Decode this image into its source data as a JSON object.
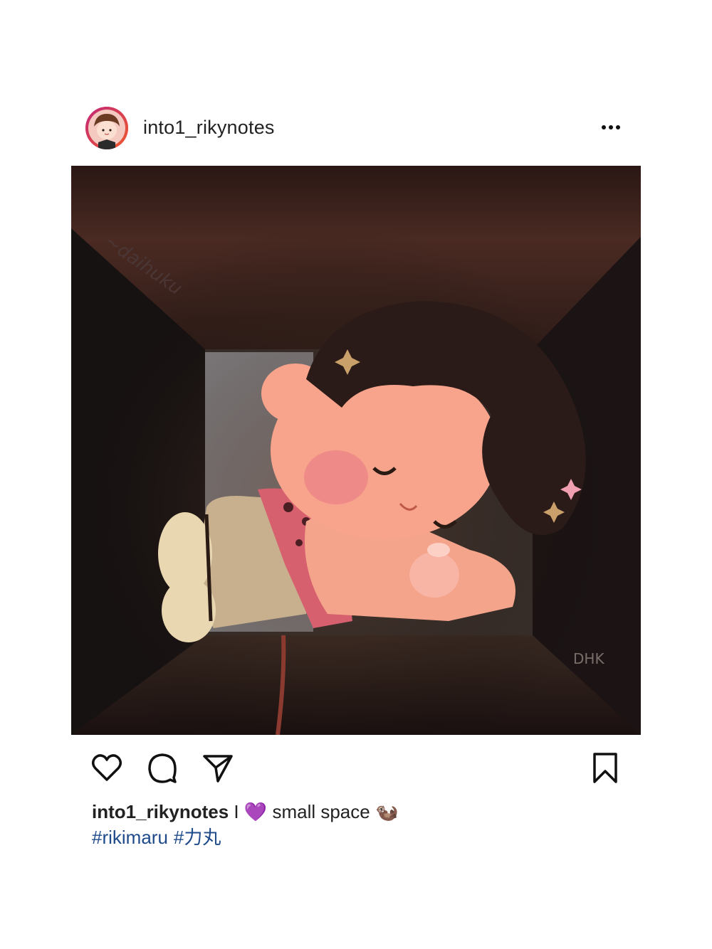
{
  "post": {
    "username": "into1_rikynotes",
    "caption_user": "into1_rikynotes",
    "caption_text": "I 💜 small space 🦦",
    "hashtags": [
      "#rikimaru",
      "#力丸"
    ],
    "image_watermark_top": "~daihuku",
    "image_watermark_bottom": "DHK"
  },
  "icons": {
    "more": "more-options-icon",
    "like": "heart-icon",
    "comment": "comment-icon",
    "share": "send-icon",
    "save": "bookmark-icon"
  },
  "colors": {
    "avatar_ring": "#e0245e",
    "hashtag": "#1e4a8a",
    "background": "#ffffff"
  }
}
